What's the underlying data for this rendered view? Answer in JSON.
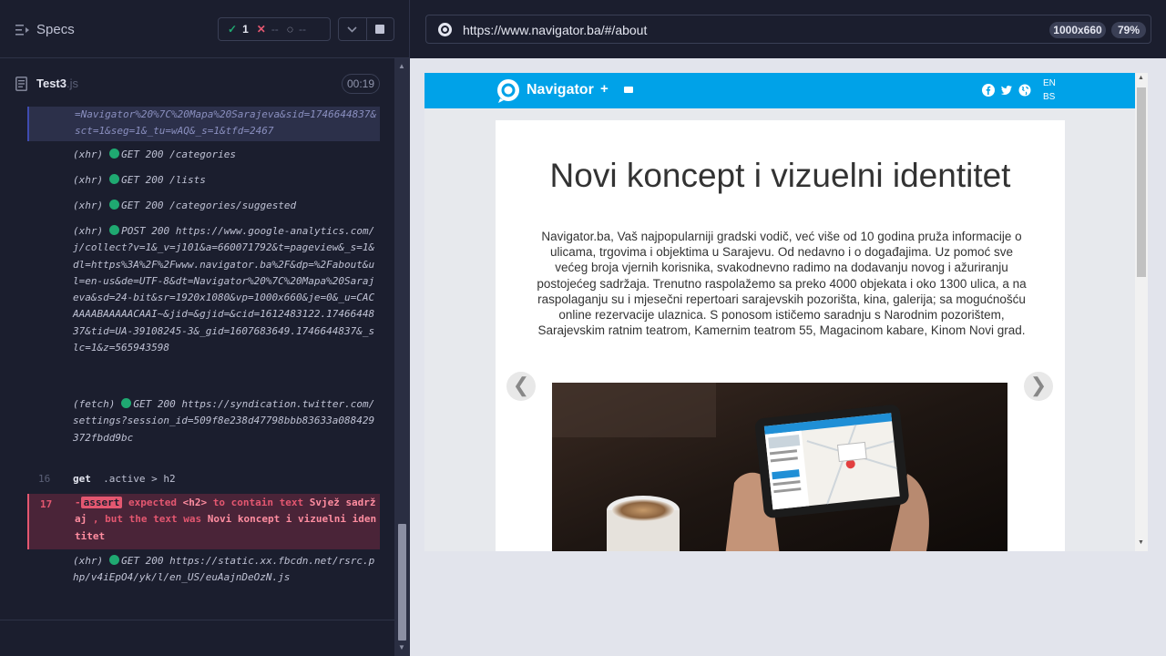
{
  "runner": {
    "specs_label": "Specs",
    "passed_count": "1",
    "failed_count": "--",
    "pending_count": "--",
    "file_name": "Test3",
    "file_ext": ".js",
    "timer": "00:19"
  },
  "log": {
    "url_fragment": "=Navigator%20%7C%20Mapa%20Sarajeva&sid=1746644837&sct=1&seg=1&_tu=wAQ&_s=1&tfd=2467",
    "entries": [
      {
        "type": "(xhr)",
        "text": "GET 200 /categories"
      },
      {
        "type": "(xhr)",
        "text": "GET 200 /lists"
      },
      {
        "type": "(xhr)",
        "text": "GET 200 /categories/suggested"
      },
      {
        "type": "(xhr)",
        "text": "POST 200 https://www.google-analytics.com/j/collect?v=1&_v=j101&a=660071792&t=pageview&_s=1&dl=https%3A%2F%2Fwww.navigator.ba%2F&dp=%2Fabout&ul=en-us&de=UTF-8&dt=Navigator%20%7C%20Mapa%20Sarajeva&sd=24-bit&sr=1920x1080&vp=1000x660&je=0&_u=CACAAAABAAAAACAAI~&jid=&gjid=&cid=1612483122.1746644837&tid=UA-39108245-3&_gid=1607683649.1746644837&_slc=1&z=565943598"
      },
      {
        "type": "(fetch)",
        "text": "GET 200 https://syndication.twitter.com/settings?session_id=509f8e238d47798bbb83633a088429372fbdd9bc"
      },
      {
        "type": "(xhr)",
        "text": "GET 200 https://static.xx.fbcdn.net/rsrc.php/v4iEpO4/yk/l/en_US/euAajnDeOzN.js"
      }
    ],
    "step16_num": "16",
    "step16_cmd": "get",
    "step16_sel": ".active > h2",
    "step17_num": "17",
    "assert_label": "assert",
    "assert_pre": "expected",
    "assert_el": "<h2>",
    "assert_mid": "to contain text",
    "assert_expected": "Svjež sadržaj",
    "assert_post": ", but the text was",
    "assert_actual": "Novi koncept i vizuelni identitet"
  },
  "browser": {
    "url": "https://www.navigator.ba/#/about",
    "viewport": "1000x660",
    "zoom": "79%"
  },
  "site": {
    "brand": "Navigator",
    "plus": "+",
    "lang_en": "EN",
    "lang_bs": "BS",
    "title": "Novi koncept i vizuelni identitet",
    "paragraph": "Navigator.ba, Vaš najpopularniji gradski vodič, već više od 10 godina pruža informacije o ulicama, trgovima i objektima u Sarajevu. Od nedavno i o događajima. Uz pomoć sve većeg broja vjernih korisnika, svakodnevno radimo na dodavanju novog i ažuriranju postojećeg sadržaja. Trenutno raspolažemo sa preko 4000 objekata i oko 1300 ulica, a na raspolaganju su i mjesečni repertoari sarajevskih pozorišta, kina, galerija; sa mogućnošću online rezervacije ulaznica. S ponosom ističemo saradnju s Narodnim pozorištem, Sarajevskim ratnim teatrom, Kamernim teatrom 55, Magacinom kabare, Kinom Novi grad.",
    "prev": "❮",
    "next": "❯"
  },
  "colors": {
    "accent": "#00a2e8",
    "pass": "#1fa971",
    "fail": "#e45770"
  }
}
